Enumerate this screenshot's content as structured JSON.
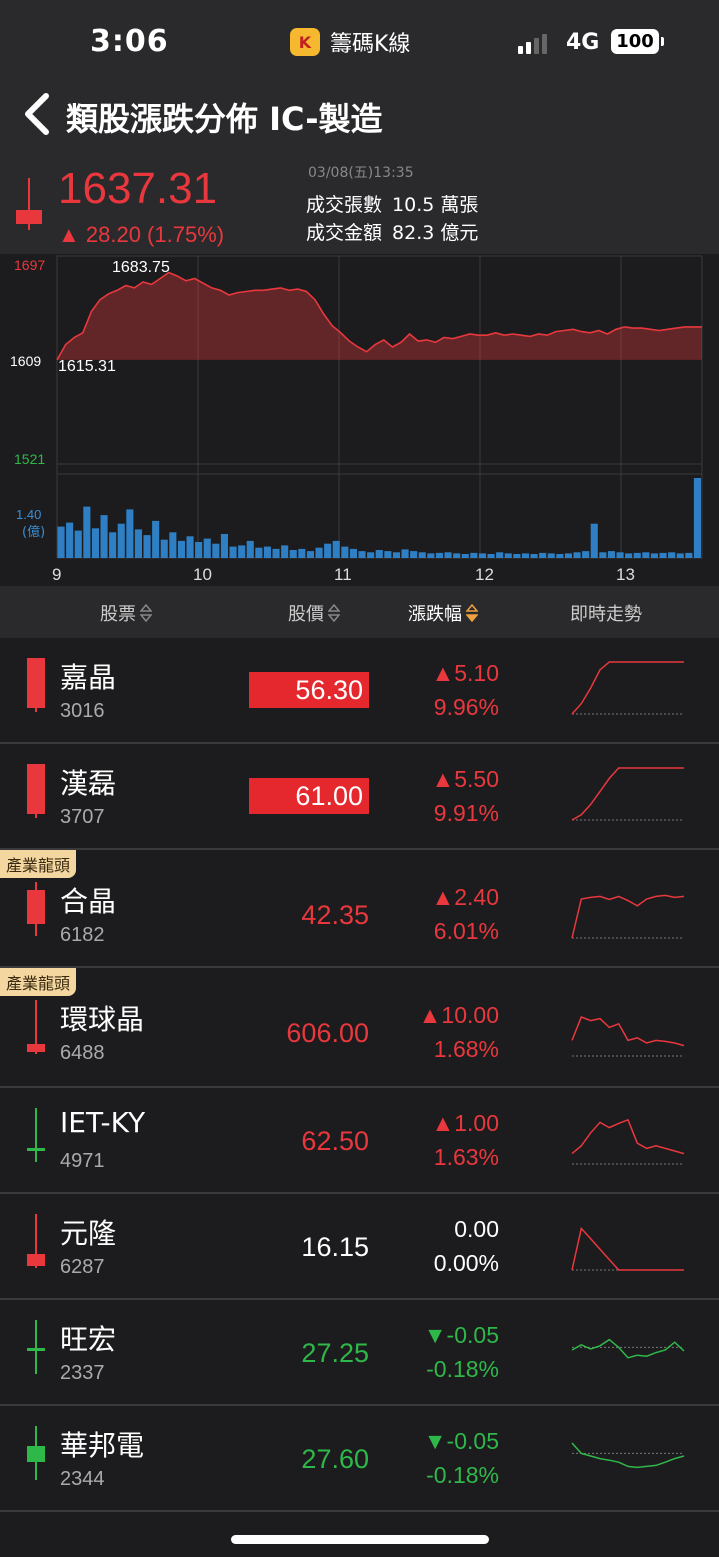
{
  "status_bar": {
    "time": "3:06",
    "app_name": "籌碼K線",
    "app_icon": "K",
    "network": "4G",
    "battery": "100"
  },
  "header": {
    "title": "類股漲跌分佈  IC-製造"
  },
  "quote": {
    "price": "1637.31",
    "change": "▲ 28.20 (1.75%)",
    "datetime": "03/08(五)13:35",
    "volume_label": "成交張數",
    "volume_value": "10.5 萬張",
    "amount_label": "成交金額",
    "amount_value": "82.3 億元",
    "up_color": "#e8383d",
    "down_color": "#2fb84a"
  },
  "chart_labels": {
    "y_top": "1697",
    "y_mid": "1609",
    "y_bottom": "1521",
    "high": "1683.75",
    "low": "1615.31",
    "vol_max": "1.40",
    "vol_unit": "(億)",
    "x_ticks": [
      "9",
      "10",
      "11",
      "12",
      "13"
    ]
  },
  "chart_data": {
    "type": "line",
    "ylim": [
      1521,
      1697
    ],
    "baseline": 1609.11,
    "high": 1683.75,
    "low": 1615.31,
    "xlabel": "",
    "ylabel": "",
    "x_ticks": [
      "9",
      "10",
      "11",
      "12",
      "13"
    ],
    "series": [
      {
        "values": [
          1609,
          1622,
          1628,
          1632,
          1650,
          1660,
          1665,
          1668,
          1672,
          1670,
          1675,
          1673,
          1678,
          1683,
          1680,
          1676,
          1678,
          1674,
          1670,
          1668,
          1664,
          1666,
          1667,
          1668,
          1668,
          1669,
          1670,
          1668,
          1669,
          1667,
          1660,
          1648,
          1638,
          1632,
          1625,
          1620,
          1616,
          1622,
          1626,
          1620,
          1624,
          1631,
          1625,
          1626,
          1624,
          1628,
          1627,
          1629,
          1631,
          1630,
          1630,
          1632,
          1630,
          1631,
          1630,
          1629,
          1631,
          1630,
          1633,
          1634,
          1635,
          1633,
          1632,
          1634,
          1631,
          1635,
          1637,
          1636,
          1636,
          1635,
          1634,
          1635,
          1636,
          1637,
          1637,
          1637
        ]
      }
    ],
    "volume": {
      "unit": "億",
      "max": 1.4,
      "values": [
        0.55,
        0.62,
        0.48,
        0.9,
        0.52,
        0.75,
        0.45,
        0.6,
        0.85,
        0.5,
        0.4,
        0.65,
        0.32,
        0.45,
        0.3,
        0.38,
        0.28,
        0.34,
        0.25,
        0.42,
        0.2,
        0.22,
        0.3,
        0.18,
        0.2,
        0.16,
        0.22,
        0.14,
        0.16,
        0.12,
        0.18,
        0.25,
        0.3,
        0.2,
        0.16,
        0.12,
        0.1,
        0.14,
        0.12,
        0.1,
        0.15,
        0.12,
        0.1,
        0.08,
        0.09,
        0.1,
        0.08,
        0.07,
        0.09,
        0.08,
        0.07,
        0.1,
        0.08,
        0.07,
        0.08,
        0.07,
        0.09,
        0.08,
        0.07,
        0.08,
        0.1,
        0.12,
        0.6,
        0.1,
        0.12,
        0.1,
        0.08,
        0.09,
        0.1,
        0.08,
        0.09,
        0.1,
        0.08,
        0.09,
        1.4
      ]
    }
  },
  "columns": {
    "stock": "股票",
    "price": "股價",
    "change": "漲跌幅",
    "trend": "即時走勢",
    "active_sort_color": "#f0a040"
  },
  "stocks": [
    {
      "name": "嘉晶",
      "code": "3016",
      "price": "56.30",
      "change": "▲5.10",
      "pct": "9.96%",
      "dir": "up",
      "boxed": true,
      "leader": "",
      "spark": [
        0,
        0.2,
        0.5,
        0.85,
        1,
        1,
        1,
        1,
        1,
        1,
        1,
        1,
        1
      ]
    },
    {
      "name": "漢磊",
      "code": "3707",
      "price": "61.00",
      "change": "▲5.50",
      "pct": "9.91%",
      "dir": "up",
      "boxed": true,
      "leader": "",
      "spark": [
        0,
        0.1,
        0.3,
        0.55,
        0.8,
        1,
        1,
        1,
        1,
        1,
        1,
        1,
        1
      ]
    },
    {
      "name": "合晶",
      "code": "6182",
      "price": "42.35",
      "change": "▲2.40",
      "pct": "6.01%",
      "dir": "up",
      "boxed": false,
      "leader": "產業龍頭",
      "spark": [
        0,
        0.75,
        0.78,
        0.8,
        0.74,
        0.8,
        0.72,
        0.62,
        0.75,
        0.8,
        0.82,
        0.78,
        0.8
      ]
    },
    {
      "name": "環球晶",
      "code": "6488",
      "price": "606.00",
      "change": "▲10.00",
      "pct": "1.68%",
      "dir": "up",
      "boxed": false,
      "leader": "產業龍頭",
      "spark": [
        0.3,
        0.75,
        0.68,
        0.72,
        0.55,
        0.62,
        0.3,
        0.35,
        0.25,
        0.3,
        0.28,
        0.25,
        0.2
      ]
    },
    {
      "name": "IET-KY",
      "code": "4971",
      "price": "62.50",
      "change": "▲1.00",
      "pct": "1.63%",
      "dir": "up",
      "boxed": false,
      "leader": "",
      "spark": [
        0.2,
        0.35,
        0.6,
        0.8,
        0.7,
        0.78,
        0.85,
        0.4,
        0.3,
        0.35,
        0.3,
        0.25,
        0.2
      ]
    },
    {
      "name": "元隆",
      "code": "6287",
      "price": "16.15",
      "change": "0.00",
      "pct": "0.00%",
      "dir": "flat",
      "boxed": false,
      "leader": "",
      "spark": [
        0,
        0.8,
        0.6,
        0.4,
        0.2,
        0,
        0,
        0,
        0,
        0,
        0,
        0,
        0
      ]
    },
    {
      "name": "旺宏",
      "code": "2337",
      "price": "27.25",
      "change": "▼-0.05",
      "pct": "-0.18%",
      "dir": "down",
      "boxed": false,
      "leader": "",
      "spark": [
        0.5,
        0.6,
        0.52,
        0.58,
        0.7,
        0.55,
        0.35,
        0.4,
        0.38,
        0.45,
        0.5,
        0.65,
        0.48
      ]
    },
    {
      "name": "華邦電",
      "code": "2344",
      "price": "27.60",
      "change": "▼-0.05",
      "pct": "-0.18%",
      "dir": "down",
      "boxed": false,
      "leader": "",
      "spark": [
        0.75,
        0.55,
        0.5,
        0.45,
        0.42,
        0.38,
        0.3,
        0.28,
        0.3,
        0.32,
        0.38,
        0.45,
        0.5
      ]
    }
  ]
}
